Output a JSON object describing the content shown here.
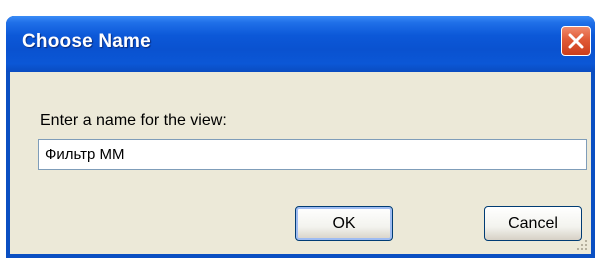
{
  "window": {
    "title": "Choose Name",
    "close_icon": "close-icon"
  },
  "dialog": {
    "prompt": "Enter a name for the view:",
    "name_value": "Фильтр ММ",
    "ok_label": "OK",
    "cancel_label": "Cancel",
    "grip_icon": "resize-grip-icon"
  },
  "colors": {
    "titlebar": "#0a52d0",
    "client_background": "#ece9d8",
    "close_button": "#e05a36"
  }
}
